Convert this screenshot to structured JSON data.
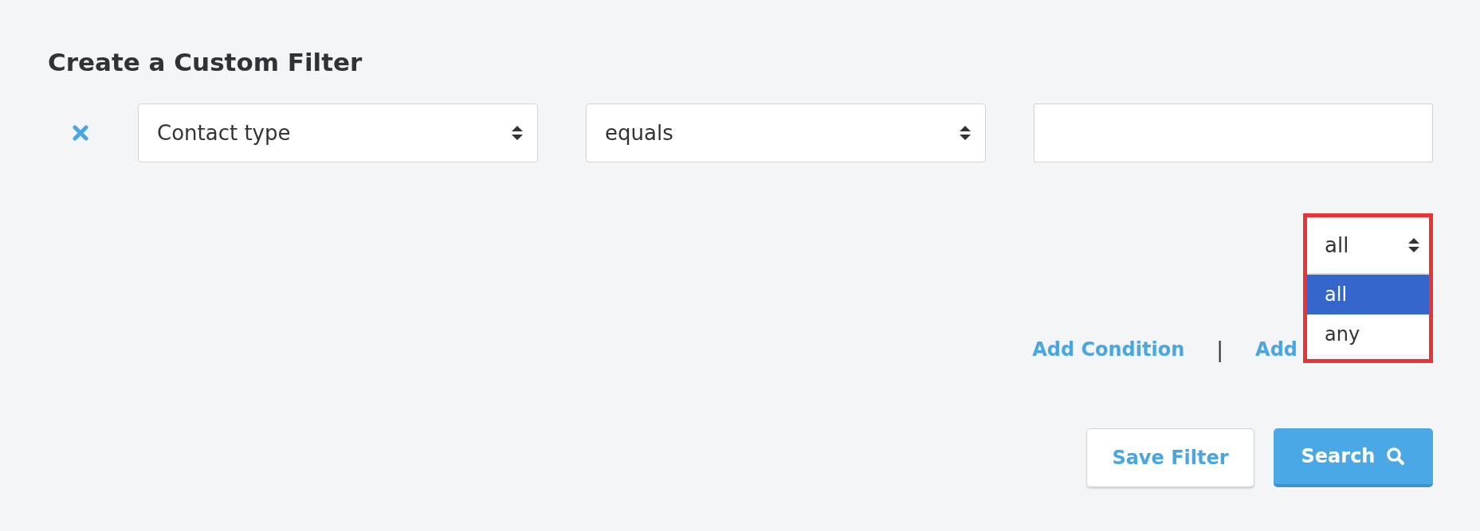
{
  "title": "Create a Custom Filter",
  "conditions": [
    {
      "field": "Contact type",
      "operator": "equals"
    }
  ],
  "match": {
    "value": "all",
    "expanded": true,
    "highlighted": true,
    "options": [
      {
        "label": "all",
        "selected": true
      },
      {
        "label": "any",
        "selected": false
      }
    ]
  },
  "links": [
    "Add Condition",
    "Add"
  ],
  "separator": "|",
  "buttons": [
    {
      "label": "Save Filter",
      "kind": "secondary"
    },
    {
      "label": "Search",
      "kind": "primary"
    }
  ]
}
